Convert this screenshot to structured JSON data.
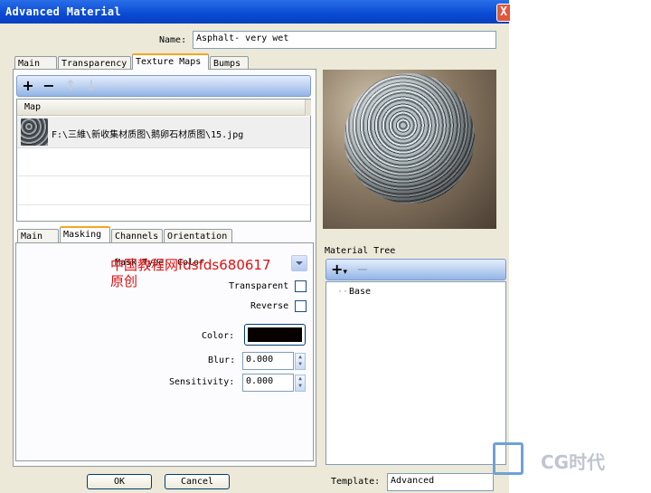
{
  "window": {
    "title": "Advanced Material",
    "close_glyph": "X"
  },
  "name_field": {
    "label": "Name:",
    "value": "Asphalt- very wet"
  },
  "top_tabs": [
    "Main",
    "Transparency",
    "Texture Maps",
    "Bumps"
  ],
  "map_list": {
    "column_header": "Map",
    "items": [
      {
        "path": "F:\\三維\\新收集材质图\\鹅卵石材质图\\15.jpg"
      }
    ]
  },
  "sub_tabs": [
    "Main",
    "Masking",
    "Channels",
    "Orientation"
  ],
  "masking": {
    "mask_type_label": "Mask Type:",
    "mask_type_value": "Color",
    "transparent_label": "Transparent",
    "transparent_checked": false,
    "reverse_label": "Reverse",
    "reverse_checked": false,
    "color_label": "Color:",
    "color_value": "#080000",
    "blur_label": "Blur:",
    "blur_value": "0.000",
    "sensitivity_label": "Sensitivity:",
    "sensitivity_value": "0.000"
  },
  "watermark": {
    "line1": "中国教程网fdsfds680617",
    "line2": "原创"
  },
  "material_tree": {
    "label": "Material Tree",
    "items": [
      "Base"
    ]
  },
  "template": {
    "label": "Template:",
    "value": "Advanced"
  },
  "buttons": {
    "ok": "OK",
    "cancel": "Cancel"
  },
  "logo_text": "CG时代",
  "accent_colors": {
    "titlebar": "#0a4ad4",
    "watermark": "#e01010"
  }
}
